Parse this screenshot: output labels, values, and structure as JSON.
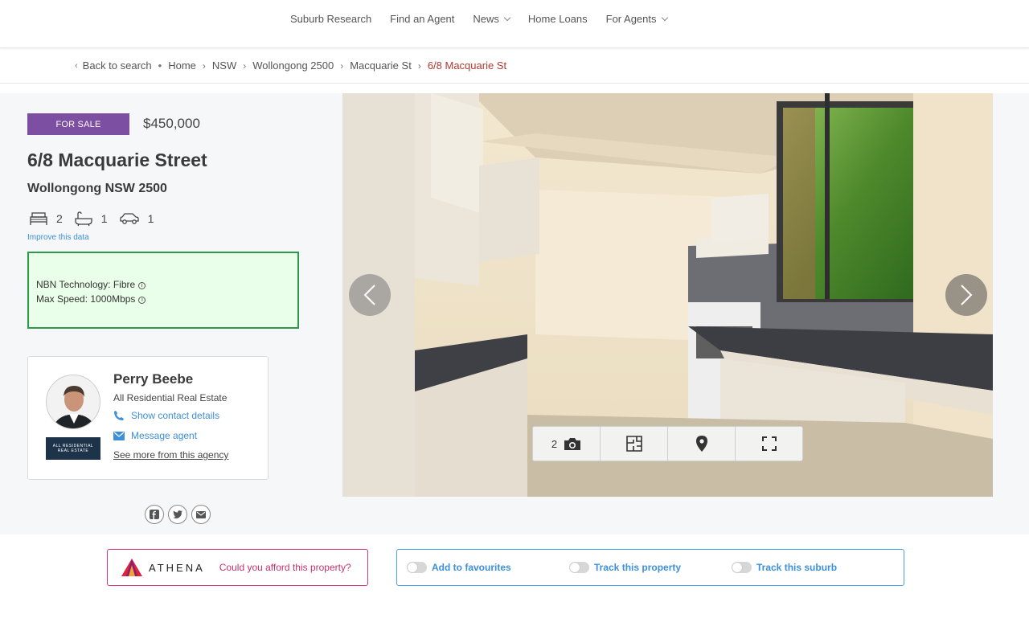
{
  "nav": {
    "items": [
      {
        "label": "Suburb Research",
        "dropdown": false
      },
      {
        "label": "Find an Agent",
        "dropdown": false
      },
      {
        "label": "News",
        "dropdown": true
      },
      {
        "label": "Home Loans",
        "dropdown": false
      },
      {
        "label": "For Agents",
        "dropdown": true
      }
    ]
  },
  "breadcrumb": {
    "back": "Back to search",
    "items": [
      "Home",
      "NSW",
      "Wollongong 2500",
      "Macquarie St"
    ],
    "current": "6/8 Macquarie St"
  },
  "listing": {
    "status": "FOR SALE",
    "price": "$450,000",
    "title": "6/8 Macquarie Street",
    "suburb": "Wollongong NSW 2500",
    "beds": "2",
    "baths": "1",
    "cars": "1",
    "improve_link": "Improve this data",
    "nbn_technology": "NBN Technology: Fibre",
    "max_speed": "Max Speed: 1000Mbps",
    "status_color": "#7d4fa3"
  },
  "agent": {
    "name": "Perry Beebe",
    "agency": "All Residential Real Estate",
    "logo_line1": "ALL RESIDENTIAL",
    "logo_line2": "REAL ESTATE",
    "show_contact": "Show contact details",
    "message": "Message agent",
    "see_more": "See more from this agency"
  },
  "gallery": {
    "photo_count": "2"
  },
  "athena": {
    "brand": "ATHENA",
    "question": "Could you afford this property?"
  },
  "tracking": {
    "favourites": "Add to favourites",
    "property": "Track this property",
    "suburb": "Track this suburb"
  }
}
